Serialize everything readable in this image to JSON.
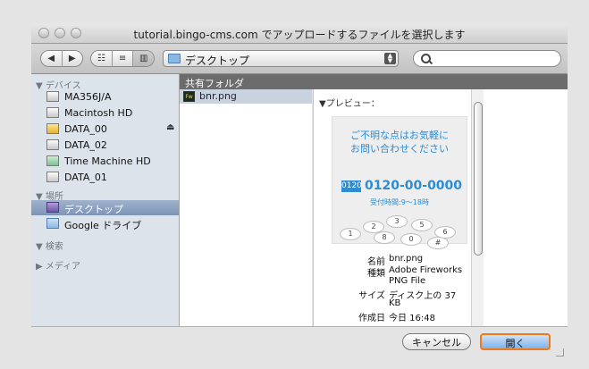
{
  "window": {
    "title": "tutorial.bingo-cms.com でアップロードするファイルを選択します"
  },
  "toolbar": {
    "back_glyph": "◀",
    "forward_glyph": "▶",
    "view_icon_glyph": "☷",
    "view_list_glyph": "≡",
    "view_column_glyph": "▥",
    "location_label": "デスクトップ",
    "search_placeholder": ""
  },
  "sidebar": {
    "devices_header": "▼ デバイス",
    "devices": [
      {
        "label": "MA356J/A",
        "icon": "drive-icon"
      },
      {
        "label": "Macintosh HD",
        "icon": "drive-icon"
      },
      {
        "label": "DATA_00",
        "icon": "drive-icon"
      },
      {
        "label": "DATA_02",
        "icon": "drive-icon"
      },
      {
        "label": "Time Machine HD",
        "icon": "timemachine-drive-icon"
      },
      {
        "label": "DATA_01",
        "icon": "drive-icon"
      }
    ],
    "places_header": "▼ 場所",
    "places": [
      {
        "label": "デスクトップ",
        "icon": "desktop-folder-icon",
        "selected": true
      },
      {
        "label": "Google ドライブ",
        "icon": "folder-icon",
        "selected": false
      }
    ],
    "search_header": "▼ 検索",
    "media_header": "▶ メディア"
  },
  "browser": {
    "column_header": "共有フォルダ",
    "files": [
      {
        "name": "bnr.png",
        "icon_text": "Fw"
      }
    ]
  },
  "preview": {
    "label": "▼プレビュー：",
    "image": {
      "line1": "ご不明な点はお気軽に",
      "line2": "お問い合わせください",
      "tel_icon": "0120",
      "tel": "0120-00-0000",
      "hours": "受付時間:9〜18時",
      "keys": [
        "1",
        "2",
        "3",
        "4",
        "5",
        "6",
        "7",
        "8",
        "9",
        "*",
        "0",
        "#"
      ]
    },
    "meta": [
      {
        "key": "名前",
        "value": "bnr.png"
      },
      {
        "key": "種類",
        "value": "Adobe Fireworks"
      },
      {
        "key": "",
        "value": "PNG File"
      },
      {
        "key": "サイズ",
        "value": "ディスク上の 37"
      },
      {
        "key": "",
        "value": "KB"
      },
      {
        "key": "作成日",
        "value": "今日 16:48"
      }
    ]
  },
  "footer": {
    "cancel_label": "キャンセル",
    "open_label": "開く"
  },
  "colors": {
    "accent_focus": "#f07a1a",
    "sidebar_bg": "#dde3ea",
    "selection": "#7e95b8",
    "ad_blue": "#2f8cd1"
  }
}
